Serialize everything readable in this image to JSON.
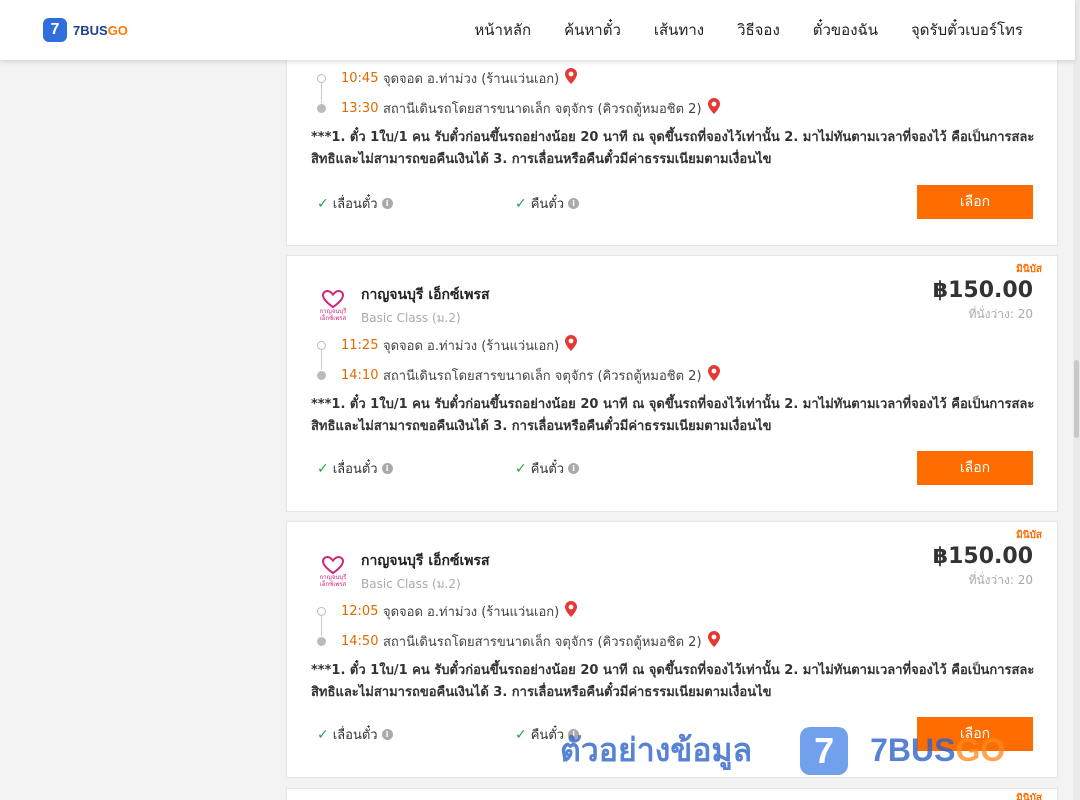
{
  "header": {
    "logo_mark": "7",
    "logo_brand": "7BUS",
    "logo_brand_accent": "GO",
    "nav": [
      "หน้าหลัก",
      "ค้นหาตั๋ว",
      "เส้นทาง",
      "วิธีจอง",
      "ตั๋วของฉัน",
      "จุดรับตั๋วเบอร์โทร"
    ]
  },
  "colors": {
    "accent": "#ff6d00",
    "time": "#e06a00",
    "check": "#22a34a",
    "pin": "#e53935",
    "brand_blue": "#2f6fdc"
  },
  "common": {
    "note": "***1. ตั๋ว 1ใบ/1 คน รับตั๋วก่อนขึ้นรถอย่างน้อย 20 นาที ณ จุดขึ้นรถที่จองไว้เท่านั้น 2. มาไม่ทันตามเวลาที่จองไว้ คือเป็นการสละสิทธิและไม่สามารถขอคืนเงินได้ 3. การเลื่อนหรือคืนตั๋วมีค่าธรรมเนียมตามเงื่อนไข",
    "reschedule": "เลื่อนตั๋ว",
    "refund": "คืนตั๋ว",
    "select": "เลือก",
    "badge": "มินิบัส",
    "operator": "กาญจนบุรี เอ็กซ์เพรส",
    "operator_logo_text": "กาญจนบุรี เอ็กซ์เพรส",
    "bus_class": "Basic Class (ม.2)",
    "price": "฿150.00",
    "seats": "ที่นั่งว่าง: 20",
    "origin": "จุดจอด อ.ท่าม่วง (ร้านแว่นเอก)",
    "destination": "สถานีเดินรถโดยสารขนาดเล็ก จตุจักร (คิวรถตู้หมอชิต 2)"
  },
  "trips": [
    {
      "depart": "10:45",
      "arrive": "13:30"
    },
    {
      "depart": "11:25",
      "arrive": "14:10"
    },
    {
      "depart": "12:05",
      "arrive": "14:50"
    }
  ],
  "watermark": {
    "text": "ตัวอย่างข้อมูล",
    "mark": "7",
    "brand": "7BUS",
    "brand_accent": "GO"
  }
}
